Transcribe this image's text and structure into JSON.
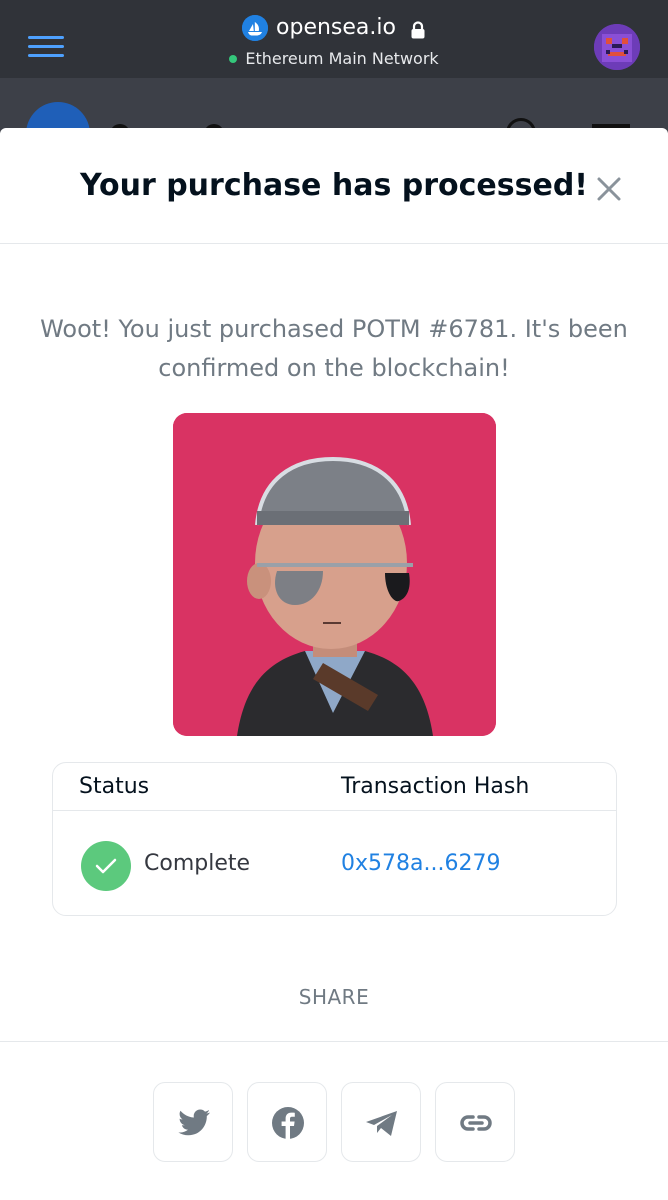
{
  "browser": {
    "url": "opensea.io",
    "network": "Ethereum Main Network",
    "colors": {
      "bar": "#303339",
      "menu_accent": "#4ea1ff",
      "network_dot": "#34c77b"
    }
  },
  "modal": {
    "title": "Your purchase has processed!",
    "message": "Woot! You just purchased POTM #6781. It's been confirmed on the blockchain!",
    "image_background": "#d93363",
    "transaction": {
      "status_header": "Status",
      "hash_header": "Transaction Hash",
      "status_value": "Complete",
      "hash_value": "0x578a...6279",
      "status_color": "#5cc97d",
      "link_color": "#2081e2"
    },
    "share": {
      "label": "SHARE",
      "buttons": [
        {
          "icon": "twitter-icon"
        },
        {
          "icon": "facebook-icon"
        },
        {
          "icon": "telegram-icon"
        },
        {
          "icon": "link-icon"
        }
      ]
    }
  }
}
